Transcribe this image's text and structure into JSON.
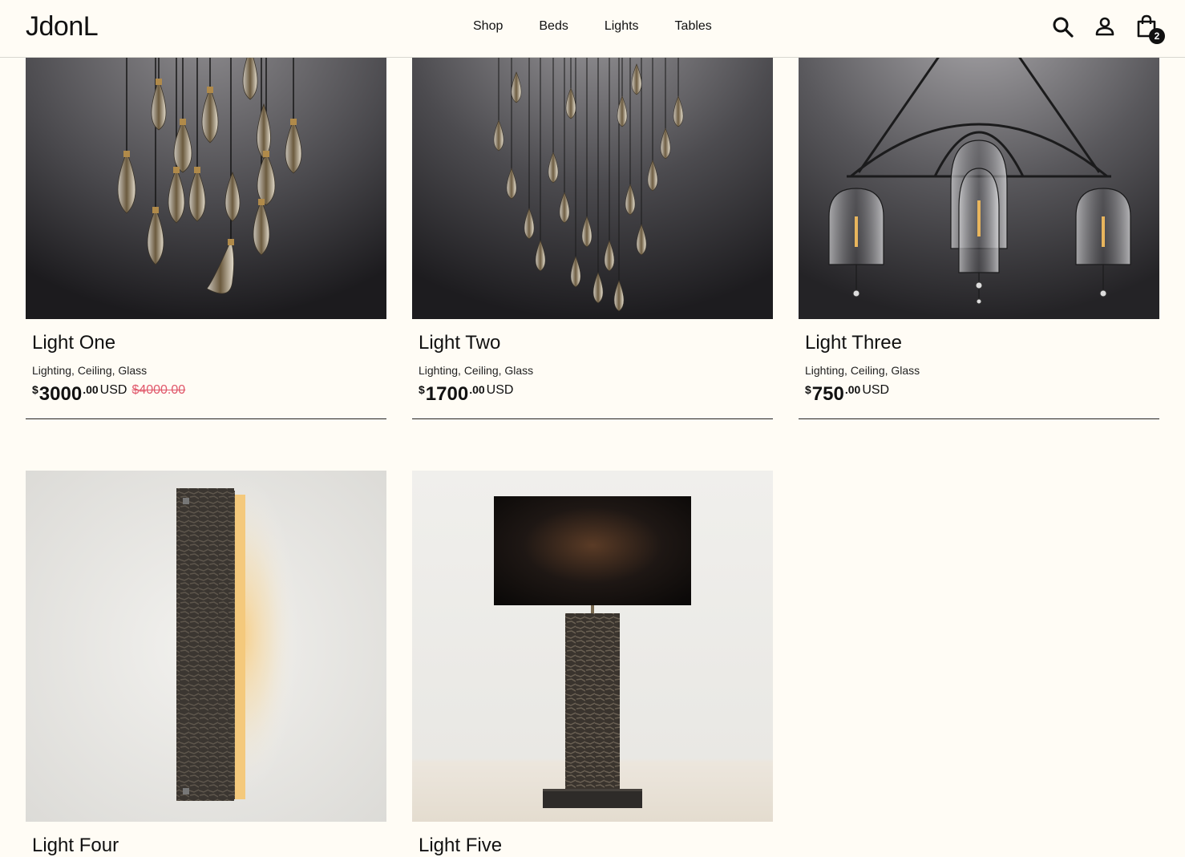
{
  "header": {
    "logo": "JdonL",
    "nav": [
      "Shop",
      "Beds",
      "Lights",
      "Tables"
    ],
    "cart_count": "2",
    "icons": [
      "search-icon",
      "account-icon",
      "cart-icon"
    ]
  },
  "products": [
    {
      "title": "Light One",
      "tags": "Lighting, Ceiling, Glass",
      "currency": "$",
      "price_int": "3000",
      "price_dec": ".00",
      "code": "USD",
      "old_price": "$4000.00"
    },
    {
      "title": "Light Two",
      "tags": "Lighting, Ceiling, Glass",
      "currency": "$",
      "price_int": "1700",
      "price_dec": ".00",
      "code": "USD",
      "old_price": ""
    },
    {
      "title": "Light Three",
      "tags": "Lighting, Ceiling, Glass",
      "currency": "$",
      "price_int": "750",
      "price_dec": ".00",
      "code": "USD",
      "old_price": ""
    },
    {
      "title": "Light Four"
    },
    {
      "title": "Light Five"
    }
  ],
  "colors": {
    "background": "#fffcf5",
    "sale_price": "#e0576a"
  }
}
